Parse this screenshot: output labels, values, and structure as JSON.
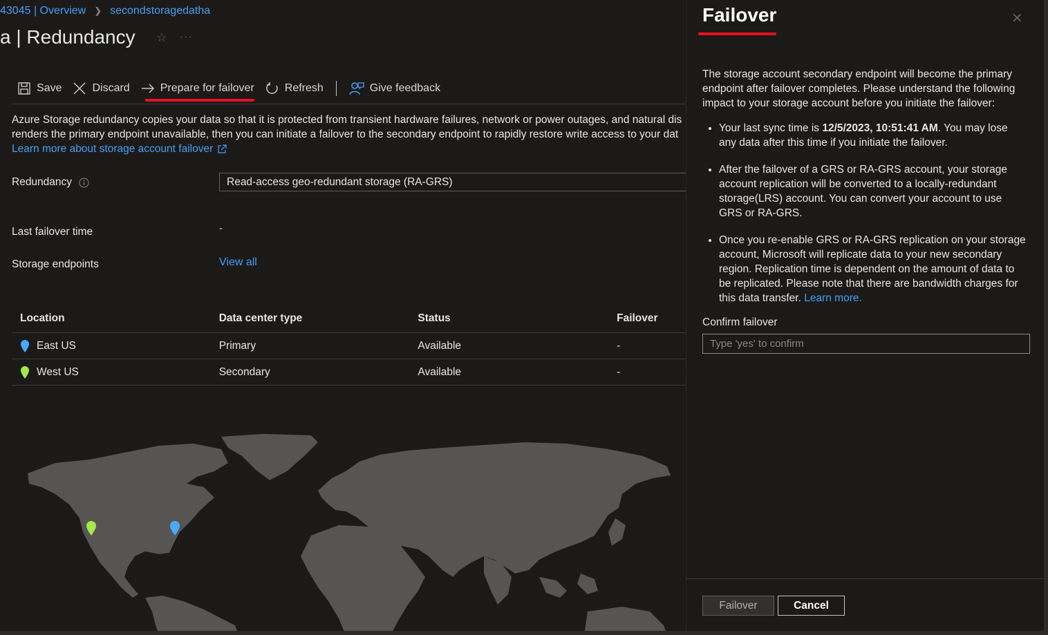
{
  "breadcrumb": {
    "item1": "43045 | Overview",
    "item2": "secondstoragedatha"
  },
  "page": {
    "title": "a | Redundancy"
  },
  "toolbar": {
    "save": "Save",
    "discard": "Discard",
    "prepare_failover": "Prepare for failover",
    "refresh": "Refresh",
    "feedback": "Give feedback"
  },
  "description": {
    "line1": "Azure Storage redundancy copies your data so that it is protected from transient hardware failures, network or power outages, and natural dis",
    "line2": "renders the primary endpoint unavailable, then you can initiate a failover to the secondary endpoint to rapidly restore write access to your dat",
    "learn_more": "Learn more about storage account failover"
  },
  "form": {
    "redundancy_label": "Redundancy",
    "redundancy_value": "Read-access geo-redundant storage (RA-GRS)",
    "last_failover_label": "Last failover time",
    "last_failover_value": "-",
    "endpoints_label": "Storage endpoints",
    "endpoints_link": "View all"
  },
  "table": {
    "headers": [
      "Location",
      "Data center type",
      "Status",
      "Failover"
    ],
    "rows": [
      {
        "location": "East US",
        "type": "Primary",
        "status": "Available",
        "failover": "-",
        "pin_color": "#4aa8ff"
      },
      {
        "location": "West US",
        "type": "Secondary",
        "status": "Available",
        "failover": "-",
        "pin_color": "#a4e84a"
      }
    ]
  },
  "panel": {
    "title": "Failover",
    "intro": "The storage account secondary endpoint will become the primary endpoint after failover completes. Please understand the following impact to your storage account before you initiate the failover:",
    "bullet1_pre": "Your last sync time is ",
    "bullet1_bold": "12/5/2023, 10:51:41 AM",
    "bullet1_post": ". You may lose any data after this time if you initiate the failover.",
    "bullet2": "After the failover of a GRS or RA-GRS account, your storage account replication will be converted to a locally-redundant storage(LRS) account. You can convert your account to use GRS or RA-GRS.",
    "bullet3": "Once you re-enable GRS or RA-GRS replication on your storage account, Microsoft will replicate data to your new secondary region. Replication time is dependent on the amount of data to be replicated. Please note that there are bandwidth charges for this data transfer. ",
    "bullet3_link": "Learn more.",
    "confirm_label": "Confirm failover",
    "confirm_placeholder": "Type 'yes' to confirm",
    "failover_button": "Failover",
    "cancel_button": "Cancel"
  },
  "colors": {
    "accent_link": "#479ef5",
    "highlight_red": "#e81123",
    "map_land": "#575553",
    "east_pin": "#4aa8ff",
    "west_pin": "#a4e84a"
  }
}
